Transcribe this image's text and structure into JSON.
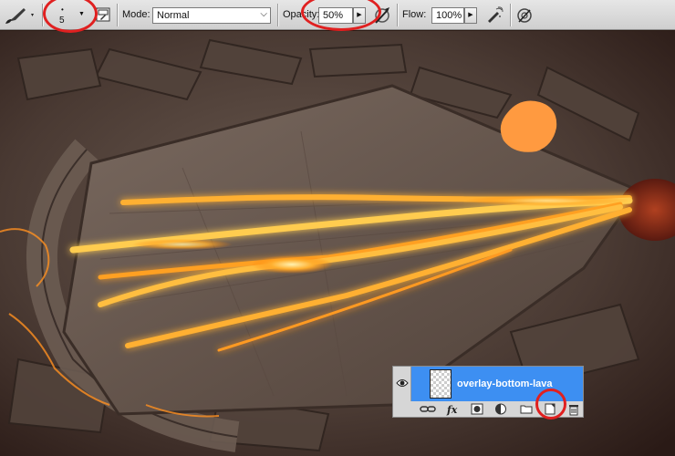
{
  "options_bar": {
    "brush_size": "5",
    "mode_label": "Mode:",
    "mode_value": "Normal",
    "opacity_label": "Opacity:",
    "opacity_value": "50%",
    "flow_label": "Flow:",
    "flow_value": "100%"
  },
  "icons": {
    "brush_tool": "brush-icon",
    "brush_panel": "brush-panel-toggle-icon",
    "pressure_opacity": "pressure-opacity-icon",
    "airbrush": "airbrush-icon",
    "pressure_size": "pressure-size-icon"
  },
  "layers_panel": {
    "layer_name": "overlay-bottom-lava",
    "visible": true,
    "selection_color": "#3d8ff2",
    "footer_icons": [
      "link-layers-icon",
      "fx-icon",
      "layer-mask-icon",
      "adjustment-layer-icon",
      "group-folder-icon",
      "new-layer-icon",
      "trash-icon"
    ]
  },
  "annotations": {
    "color": "#e02020",
    "circled": [
      "brush-size",
      "opacity",
      "new-layer-button"
    ]
  },
  "canvas": {
    "description_colors": {
      "stone": "#5a4a42",
      "lava": "#ffb030",
      "brush_dab": "#ff9a40"
    }
  }
}
